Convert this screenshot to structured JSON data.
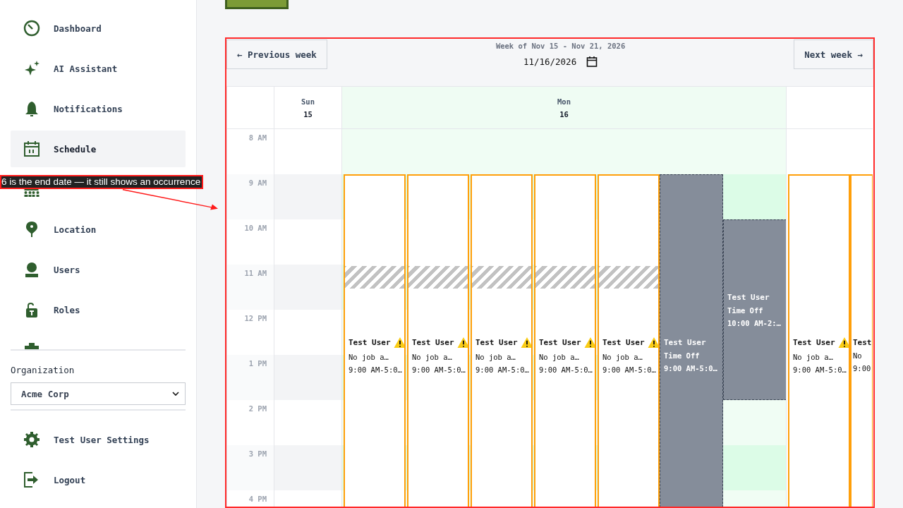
{
  "sidebar": {
    "items": [
      {
        "label": "Dashboard",
        "selected": false
      },
      {
        "label": "AI Assistant",
        "selected": false
      },
      {
        "label": "Notifications",
        "selected": false
      },
      {
        "label": "Schedule",
        "selected": true
      },
      {
        "selected": false
      },
      {
        "label": "Location",
        "selected": false
      },
      {
        "label": "Users",
        "selected": false
      },
      {
        "label": "Roles",
        "selected": false
      },
      {
        "selected": false
      }
    ],
    "organization": {
      "label": "Organization",
      "value": "Acme Corp"
    },
    "footer_items": [
      {
        "label": "Test User Settings"
      },
      {
        "label": "Logout"
      }
    ]
  },
  "calendar": {
    "prev_button": "← Previous week",
    "next_button": "Next week →",
    "week_label": "Week of Nov 15 - Nov 21, 2026",
    "date": "11/16/2026",
    "days": [
      {
        "name": "Sun",
        "date": "15",
        "selected": false
      },
      {
        "name": "Mon",
        "date": "16",
        "selected": true
      }
    ],
    "hours": [
      "8 AM",
      "9 AM",
      "10 AM",
      "11 AM",
      "12 PM",
      "1 PM",
      "2 PM",
      "3 PM",
      "4 PM"
    ],
    "mon_events": [
      {
        "kind": "shift",
        "name": "Test User",
        "detail": "No job a…",
        "time": "9:00 AM-5:0…",
        "warning": true,
        "has_break": true
      },
      {
        "kind": "shift",
        "name": "Test User",
        "detail": "No job a…",
        "time": "9:00 AM-5:0…",
        "warning": true,
        "has_break": true
      },
      {
        "kind": "shift",
        "name": "Test User",
        "detail": "No job a…",
        "time": "9:00 AM-5:0…",
        "warning": true,
        "has_break": true
      },
      {
        "kind": "shift",
        "name": "Test User",
        "detail": "No job a…",
        "time": "9:00 AM-5:0…",
        "warning": true,
        "has_break": true
      },
      {
        "kind": "shift",
        "name": "Test User",
        "detail": "No job a…",
        "time": "9:00 AM-5:0…",
        "warning": true,
        "has_break": true
      },
      {
        "kind": "time_off",
        "name": "Test User",
        "detail": "Time Off",
        "time": "9:00 AM-5:0…"
      },
      {
        "kind": "time_off",
        "name": "Test User",
        "detail": "Time Off",
        "time": "10:00 AM-2:…"
      }
    ],
    "next_events": [
      {
        "kind": "shift",
        "name": "Test User",
        "detail": "No job a…",
        "time": "9:00 AM-5:0…",
        "warning": true
      },
      {
        "kind": "shift",
        "name": "Test",
        "detail": "No",
        "time": "9:00"
      }
    ]
  },
  "annotation": {
    "text": "6 is the end date — it still shows an occurrence",
    "highlighted": true
  }
}
